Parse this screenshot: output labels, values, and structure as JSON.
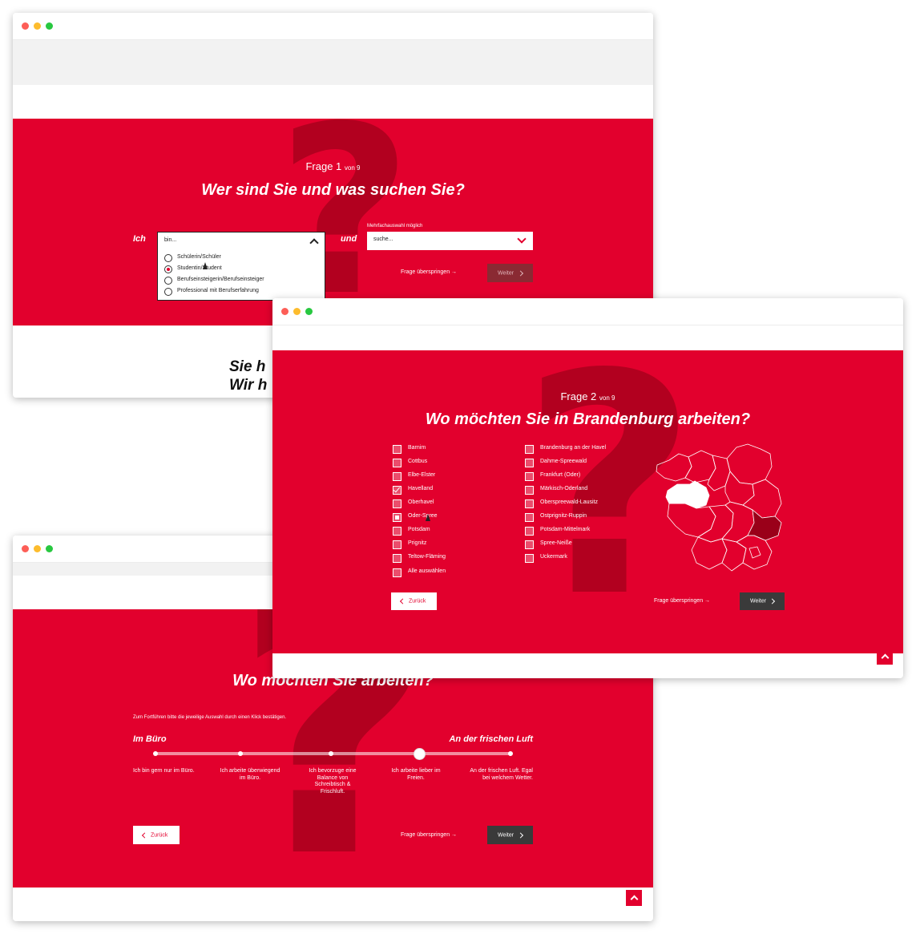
{
  "q1": {
    "frage": "Frage 1",
    "of": "von 9",
    "title": "Wer sind Sie und was suchen Sie?",
    "ich": "Ich",
    "und": "und",
    "dropdown_value": "bin...",
    "options": [
      "Schülerin/Schüler",
      "Studentin/Student",
      "Berufseinsteigerin/Berufseinsteiger",
      "Professional mit Berufserfahrung"
    ],
    "selected_index": 1,
    "multi_hint": "Mehrfachauswahl möglich",
    "search_value": "suche...",
    "skip": "Frage überspringen →",
    "next": "Weiter",
    "below_line1": "Sie h",
    "below_line2": "Wir h"
  },
  "q2": {
    "frage": "Frage 2",
    "of": "von 9",
    "title": "Wo möchten Sie in Brandenburg arbeiten?",
    "left_options": [
      "Barnim",
      "Cottbus",
      "Elbe-Elster",
      "Havelland",
      "Oberhavel",
      "Oder-Spree",
      "Potsdam",
      "Prignitz",
      "Teltow-Fläming",
      "Alle auswählen"
    ],
    "right_options": [
      "Brandenburg an der Havel",
      "Dahme-Spreewald",
      "Frankfurt (Oder)",
      "Märkisch-Oderland",
      "Oberspreewald-Lausitz",
      "Ostprignitz-Ruppin",
      "Potsdam-Mittelmark",
      "Spree-Neiße",
      "Uckermark"
    ],
    "back": "Zurück",
    "skip": "Frage überspringen →",
    "next": "Weiter"
  },
  "q3": {
    "title": "Wo möchten Sie arbeiten?",
    "hint": "Zum Fortführen bitte die jeweilige Auswahl durch einen Klick bestätigen.",
    "left_label": "Im Büro",
    "right_label": "An der frischen Luft",
    "stops": [
      "Ich bin gern nur im Büro.",
      "Ich arbeite überwiegend im Büro.",
      "Ich bevorzuge eine Balance von Schreibtisch & Frischluft.",
      "Ich arbeite lieber im Freien.",
      "An der frischen Luft. Egal bei welchem Wetter."
    ],
    "slider_value": 4,
    "back": "Zurück",
    "skip": "Frage überspringen →",
    "next": "Weiter"
  },
  "colors": {
    "brand_red": "#e2002d",
    "dark_red": "#b2001f",
    "button_dark": "#3a3a3a"
  },
  "icons": [
    "chevron-up-icon",
    "chevron-down-icon",
    "chevron-right-icon",
    "chevron-left-icon",
    "arrow-up-icon",
    "checkbox-checked-icon",
    "radio-selected-icon",
    "brandenburg-map"
  ]
}
